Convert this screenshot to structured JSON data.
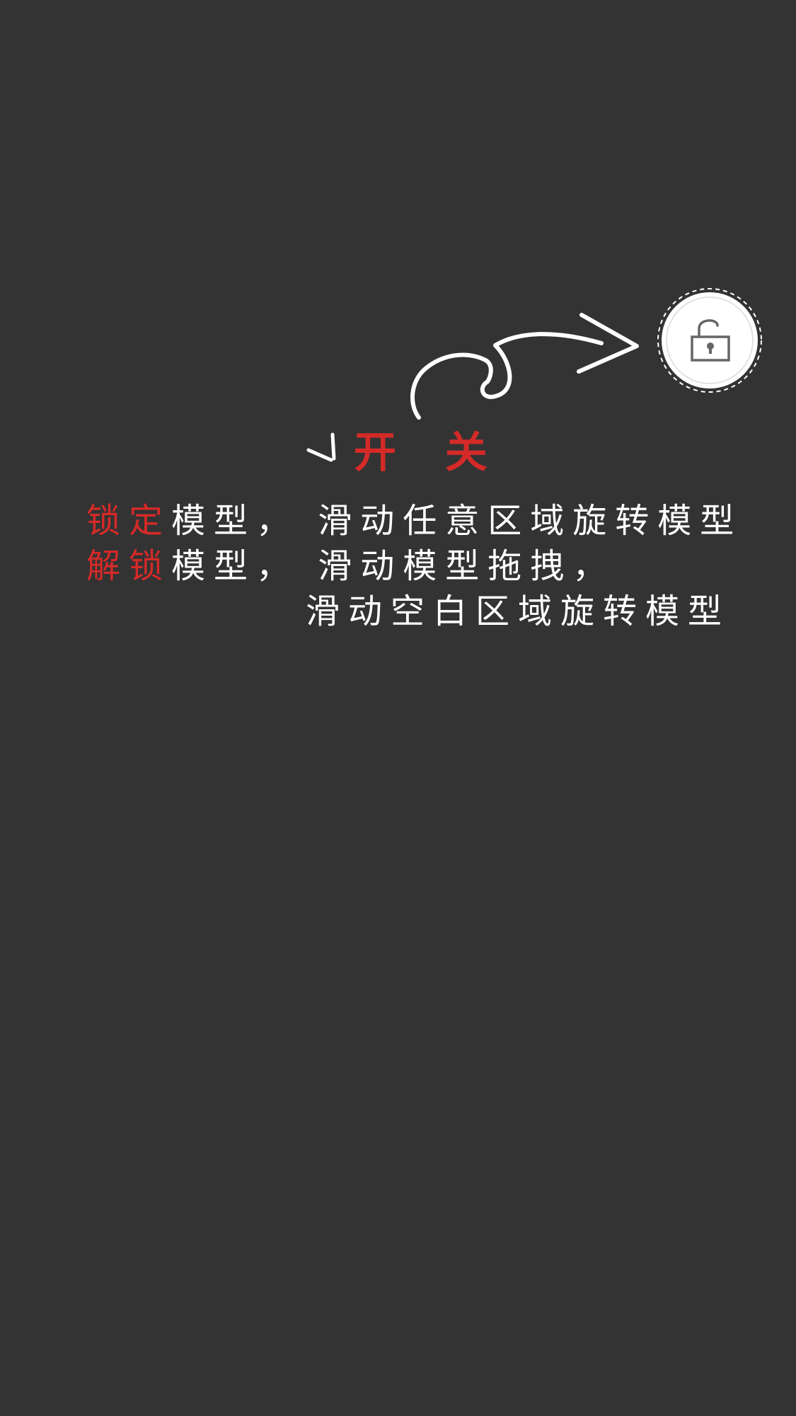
{
  "colors": {
    "background": "#333333",
    "accent": "#d42a28",
    "text": "#ffffff",
    "icon_stroke": "#666666"
  },
  "lock_toggle": {
    "icon": "unlock-icon"
  },
  "title": "开 关",
  "instructions": {
    "line1": {
      "highlight": "锁定",
      "text": "模型， 滑动任意区域旋转模型"
    },
    "line2": {
      "highlight": "解锁",
      "text": "模型， 滑动模型拖拽，"
    },
    "line3": {
      "text": "滑动空白区域旋转模型"
    }
  }
}
